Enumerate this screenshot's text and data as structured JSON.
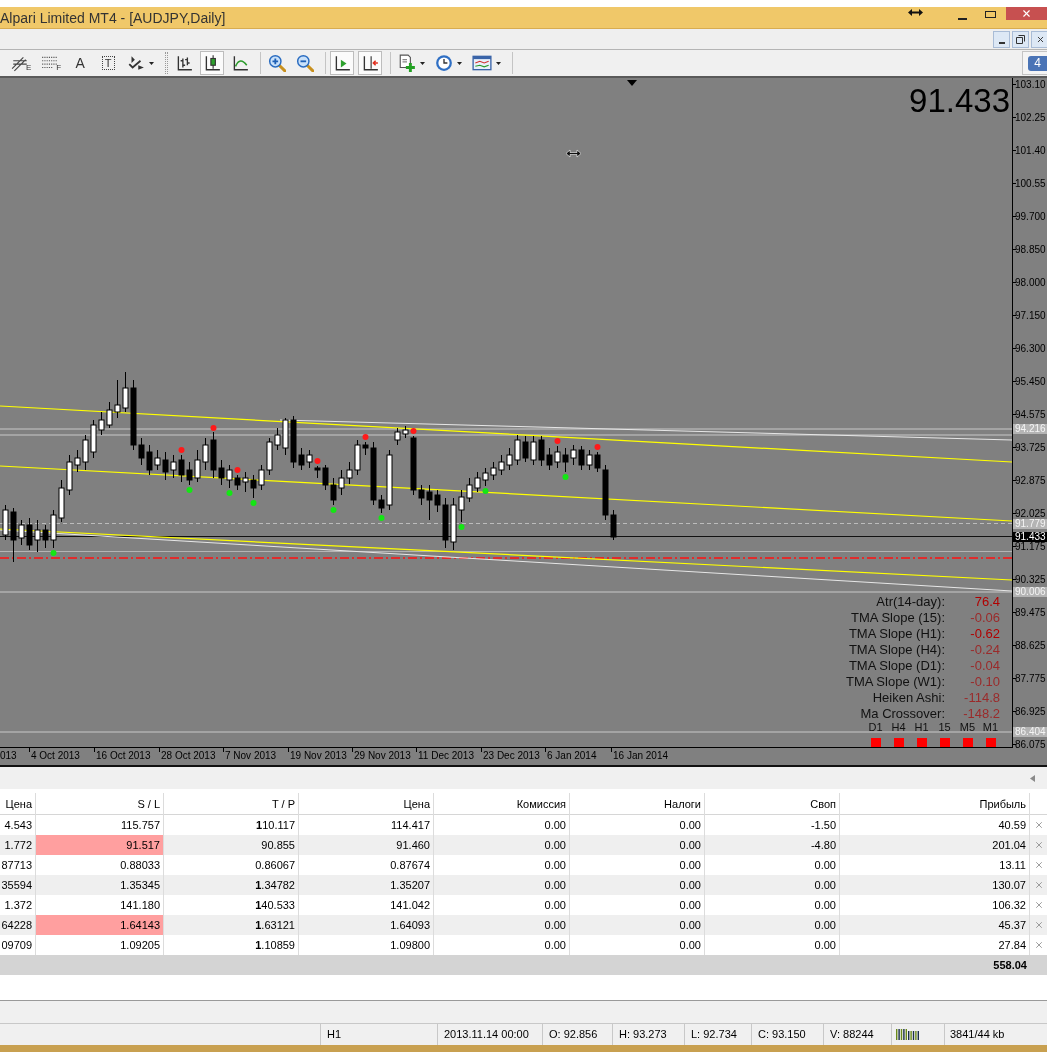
{
  "window": {
    "title": "Alpari Limited MT4 - [AUDJPY,Daily]"
  },
  "toolbar": {
    "items": [
      {
        "kind": "fibo-expansion",
        "glyph": "E",
        "pressed": false
      },
      {
        "kind": "fibo-grid",
        "glyph": "F",
        "pressed": false
      },
      {
        "kind": "text",
        "glyph": "A",
        "pressed": false
      },
      {
        "kind": "label",
        "glyph": "T",
        "pressed": false
      },
      {
        "kind": "arrows",
        "pressed": false
      },
      {
        "kind": "grip"
      },
      {
        "kind": "bar-chart",
        "pressed": false
      },
      {
        "kind": "candle-chart",
        "pressed": true
      },
      {
        "kind": "line-chart",
        "pressed": false
      },
      {
        "kind": "separator"
      },
      {
        "kind": "zoom-in",
        "pressed": false
      },
      {
        "kind": "zoom-out",
        "pressed": false
      },
      {
        "kind": "separator"
      },
      {
        "kind": "auto-scroll",
        "pressed": true
      },
      {
        "kind": "chart-shift",
        "pressed": true
      },
      {
        "kind": "separator"
      },
      {
        "kind": "indicators",
        "pressed": false
      },
      {
        "kind": "periods",
        "pressed": false
      },
      {
        "kind": "templates",
        "pressed": false
      },
      {
        "kind": "separator"
      }
    ],
    "notifications": "4"
  },
  "chart": {
    "price": "91.433",
    "price_axis": [
      "103.10",
      "102.25",
      "101.40",
      "100.55",
      "99.700",
      "98.850",
      "98.000",
      "97.150",
      "96.300",
      "95.450",
      "94.575",
      "93.725",
      "92.875",
      "92.025",
      "91.175",
      "90.325",
      "89.475",
      "88.625",
      "87.775",
      "86.925",
      "86.075"
    ],
    "markers": [
      {
        "text": "94.216",
        "kind": "level"
      },
      {
        "text": "91.779",
        "kind": "level"
      },
      {
        "text": "91.433",
        "kind": "bid"
      },
      {
        "text": "90.006",
        "kind": "level"
      },
      {
        "text": "86.404",
        "kind": "level"
      }
    ],
    "date_axis": [
      "013",
      "4 Oct 2013",
      "16 Oct 2013",
      "28 Oct 2013",
      "7 Nov 2013",
      "19 Nov 2013",
      "29 Nov 2013",
      "11 Dec 2013",
      "23 Dec 2013",
      "6 Jan 2014",
      "16 Jan 2014"
    ],
    "indicators": [
      {
        "label": "Atr(14-day):",
        "value": "76.4",
        "color": "#b00000"
      },
      {
        "label": "TMA Slope (15):",
        "value": "-0.06",
        "color": "#9a2a2a"
      },
      {
        "label": "TMA Slope (H1):",
        "value": "-0.62",
        "color": "#b00000"
      },
      {
        "label": "TMA Slope (H4):",
        "value": "-0.24",
        "color": "#9a2a2a"
      },
      {
        "label": "TMA Slope (D1):",
        "value": "-0.04",
        "color": "#9a2a2a"
      },
      {
        "label": "TMA Slope (W1):",
        "value": "-0.10",
        "color": "#9a2a2a"
      },
      {
        "label": "Heiken Ashi:",
        "value": "-114.8",
        "color": "#9a2a2a"
      },
      {
        "label": "Ma Crossover:",
        "value": "-148.2",
        "color": "#9a2a2a"
      }
    ],
    "timeframes": [
      {
        "label": "D1",
        "color": "#ff0000"
      },
      {
        "label": "H4",
        "color": "#ff0000"
      },
      {
        "label": "H1",
        "color": "#ff0000"
      },
      {
        "label": "15",
        "color": "#ff0000"
      },
      {
        "label": "M5",
        "color": "#ff0000"
      },
      {
        "label": "M1",
        "color": "#ff0000"
      }
    ]
  },
  "terminal": {
    "columns": [
      "Цена",
      "S / L",
      "T / P",
      "Цена",
      "Комиссия",
      "Налоги",
      "Своп",
      "Прибыль"
    ],
    "rows": [
      {
        "cells": [
          "4.543",
          "115.757",
          "**1**10.117",
          "114.417",
          "0.00",
          "0.00",
          "-1.50",
          "40.59"
        ],
        "sl_highlighted": false
      },
      {
        "cells": [
          "1.772",
          "91.517",
          "90.855",
          "91.460",
          "0.00",
          "0.00",
          "-4.80",
          "201.04"
        ],
        "sl_highlighted": true
      },
      {
        "cells": [
          "87713",
          "0.88033",
          "0.86067",
          "0.87674",
          "0.00",
          "0.00",
          "0.00",
          "13.11"
        ],
        "sl_highlighted": false
      },
      {
        "cells": [
          "35594",
          "1.35345",
          "**1**.34782",
          "1.35207",
          "0.00",
          "0.00",
          "0.00",
          "130.07"
        ],
        "sl_highlighted": false
      },
      {
        "cells": [
          "1.372",
          "141.180",
          "**1**40.533",
          "141.042",
          "0.00",
          "0.00",
          "0.00",
          "106.32"
        ],
        "sl_highlighted": false
      },
      {
        "cells": [
          "64228",
          "1.64143",
          "**1**.63121",
          "1.64093",
          "0.00",
          "0.00",
          "0.00",
          "45.37"
        ],
        "sl_highlighted": true
      },
      {
        "cells": [
          "09709",
          "1.09205",
          "**1**.10859",
          "1.09800",
          "0.00",
          "0.00",
          "0.00",
          "27.84"
        ],
        "sl_highlighted": false
      }
    ],
    "total": "558.04"
  },
  "status_bar": {
    "cells": [
      "H1",
      "2013.11.14 00:00",
      "O: 92.856",
      "H: 93.273",
      "L: 92.734",
      "C: 93.150",
      "V: 88244"
    ],
    "memory": "3841/44 kb"
  }
}
